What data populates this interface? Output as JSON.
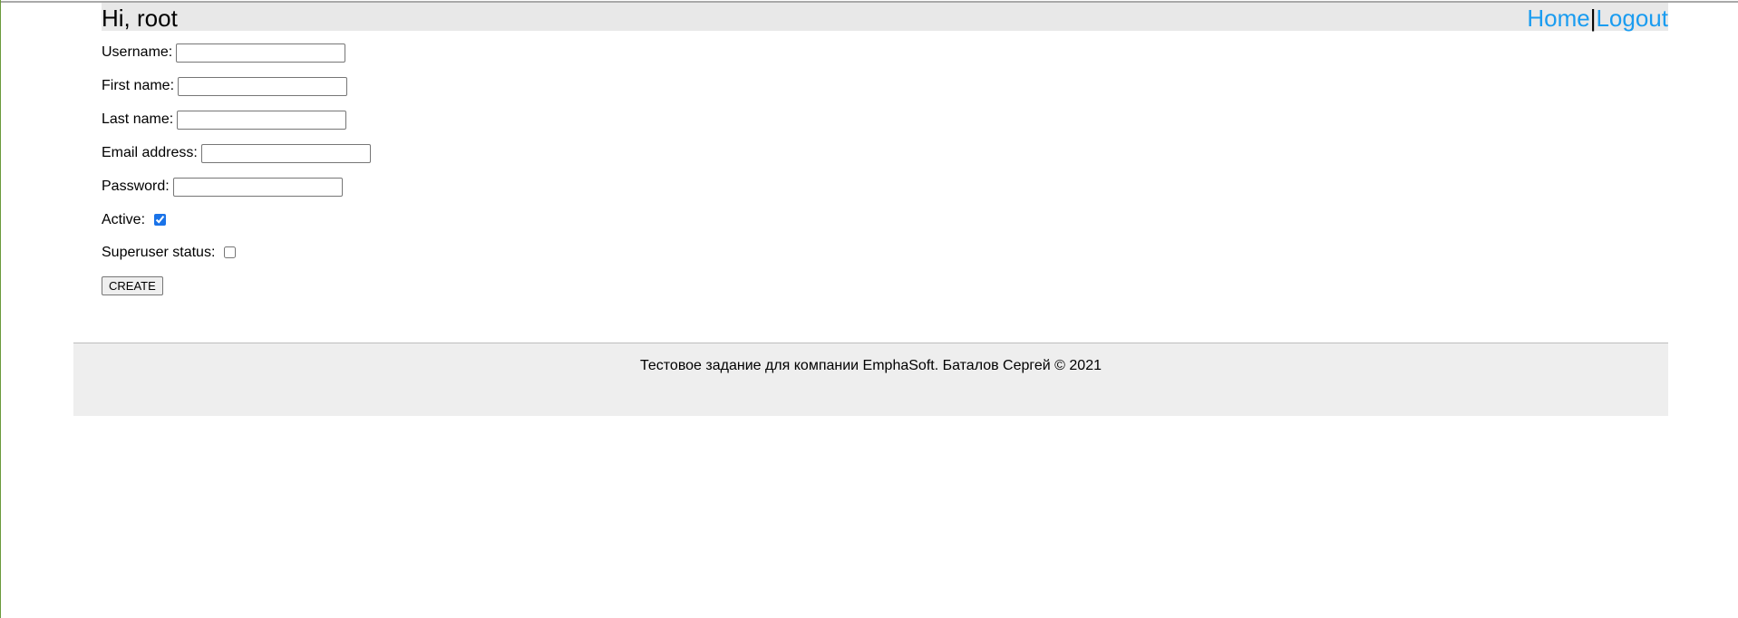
{
  "header": {
    "greeting": "Hi, root",
    "nav": {
      "home_label": "Home",
      "separator": "|",
      "logout_label": "Logout"
    }
  },
  "form": {
    "username": {
      "label": "Username:",
      "value": ""
    },
    "first_name": {
      "label": "First name:",
      "value": ""
    },
    "last_name": {
      "label": "Last name:",
      "value": ""
    },
    "email": {
      "label": "Email address:",
      "value": ""
    },
    "password": {
      "label": "Password:",
      "value": ""
    },
    "active": {
      "label": "Active:",
      "checked": true
    },
    "superuser": {
      "label": "Superuser status:",
      "checked": false
    },
    "submit_label": "CREATE"
  },
  "footer": {
    "text": "Тестовое задание для компании EmphaSoft. Баталов Сергей © 2021"
  },
  "colors": {
    "link": "#1a9cf0",
    "header_bg": "#e8e8e8",
    "footer_bg": "#eeeeee",
    "checkbox_accent": "#1a73e8"
  }
}
